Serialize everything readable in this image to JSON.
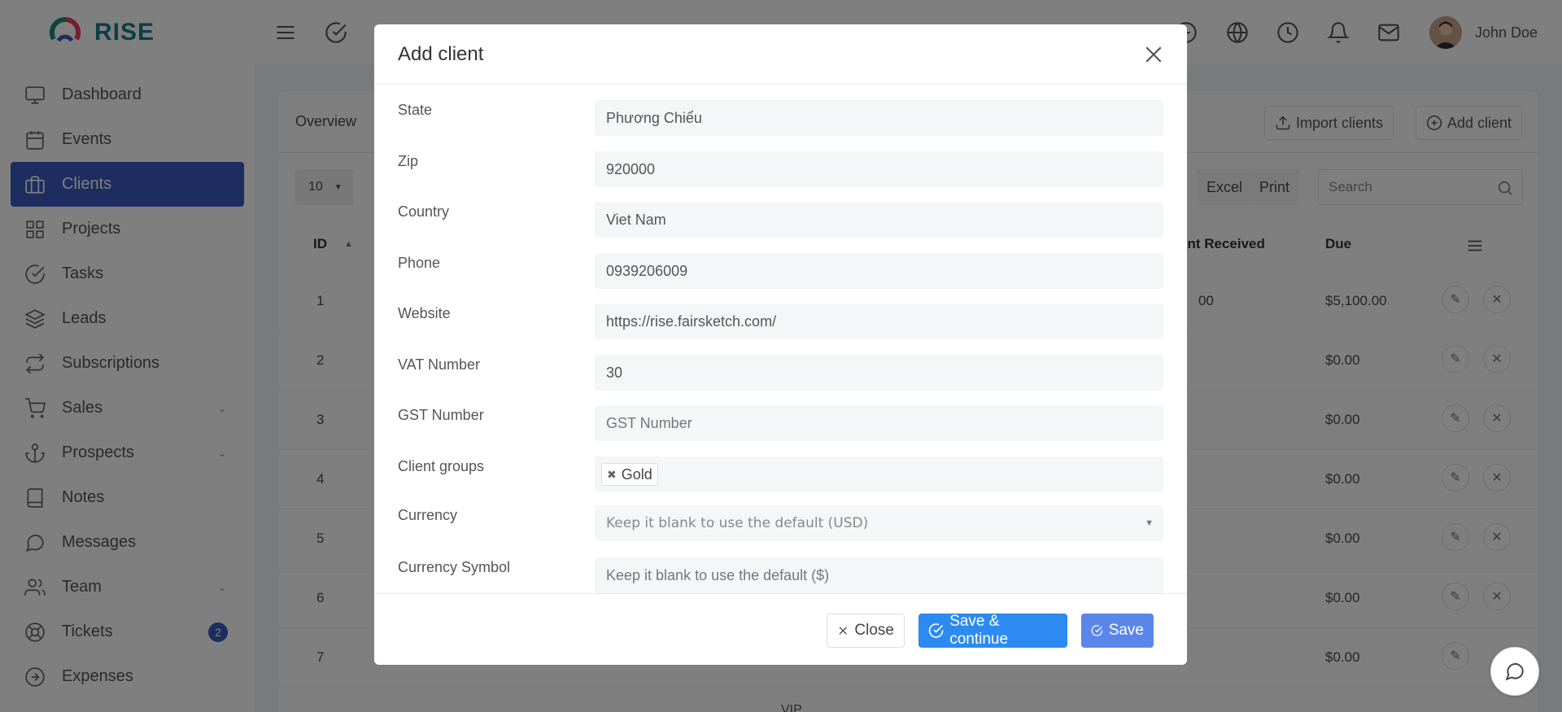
{
  "brand": {
    "name": "RISE"
  },
  "sidebar": {
    "items": [
      {
        "label": "Dashboard",
        "icon": "monitor-icon"
      },
      {
        "label": "Events",
        "icon": "calendar-icon"
      },
      {
        "label": "Clients",
        "icon": "briefcase-icon",
        "active": true
      },
      {
        "label": "Projects",
        "icon": "grid-icon"
      },
      {
        "label": "Tasks",
        "icon": "check-circle-icon"
      },
      {
        "label": "Leads",
        "icon": "layers-icon"
      },
      {
        "label": "Subscriptions",
        "icon": "repeat-icon"
      },
      {
        "label": "Sales",
        "icon": "cart-icon",
        "caret": true
      },
      {
        "label": "Prospects",
        "icon": "anchor-icon",
        "caret": true
      },
      {
        "label": "Notes",
        "icon": "book-icon"
      },
      {
        "label": "Messages",
        "icon": "message-icon"
      },
      {
        "label": "Team",
        "icon": "users-icon",
        "caret": true
      },
      {
        "label": "Tickets",
        "icon": "lifebuoy-icon",
        "badge": "2"
      },
      {
        "label": "Expenses",
        "icon": "arrow-circle-icon"
      }
    ]
  },
  "topbar": {
    "user_name": "John Doe"
  },
  "page": {
    "tab_overview": "Overview",
    "import_label": "Import clients",
    "add_label": "Add client",
    "per_page": "10",
    "excel_label": "Excel",
    "print_label": "Print",
    "search_placeholder": "Search",
    "col_id": "ID",
    "col_payment": "ent Received",
    "col_due": "Due",
    "rows": [
      {
        "id": "1",
        "due": "$5,100.00"
      },
      {
        "id": "2",
        "due": "$0.00"
      },
      {
        "id": "3",
        "due": "$0.00"
      },
      {
        "id": "4",
        "due": "$0.00"
      },
      {
        "id": "5",
        "due": "$0.00"
      },
      {
        "id": "6",
        "due": "$0.00"
      },
      {
        "id": "7",
        "due": "$0.00"
      }
    ],
    "partial_payment": "00",
    "partial_vip": "VIP"
  },
  "modal": {
    "title": "Add client",
    "fields": [
      {
        "label": "State",
        "value": "Phương Chiểu",
        "placeholder": ""
      },
      {
        "label": "Zip",
        "value": "920000",
        "placeholder": ""
      },
      {
        "label": "Country",
        "value": "Viet Nam",
        "placeholder": ""
      },
      {
        "label": "Phone",
        "value": "0939206009",
        "placeholder": ""
      },
      {
        "label": "Website",
        "value": "https://rise.fairsketch.com/",
        "placeholder": ""
      },
      {
        "label": "VAT Number",
        "value": "30",
        "placeholder": ""
      },
      {
        "label": "GST Number",
        "value": "",
        "placeholder": "GST Number"
      },
      {
        "label": "Client groups",
        "tag": "Gold"
      },
      {
        "label": "Currency",
        "value": "",
        "placeholder": "Keep it blank to use the default (USD)"
      },
      {
        "label": "Currency Symbol",
        "value": "",
        "placeholder": "Keep it blank to use the default ($)"
      }
    ],
    "close_label": "Close",
    "save_continue_label": "Save & continue",
    "save_label": "Save"
  }
}
